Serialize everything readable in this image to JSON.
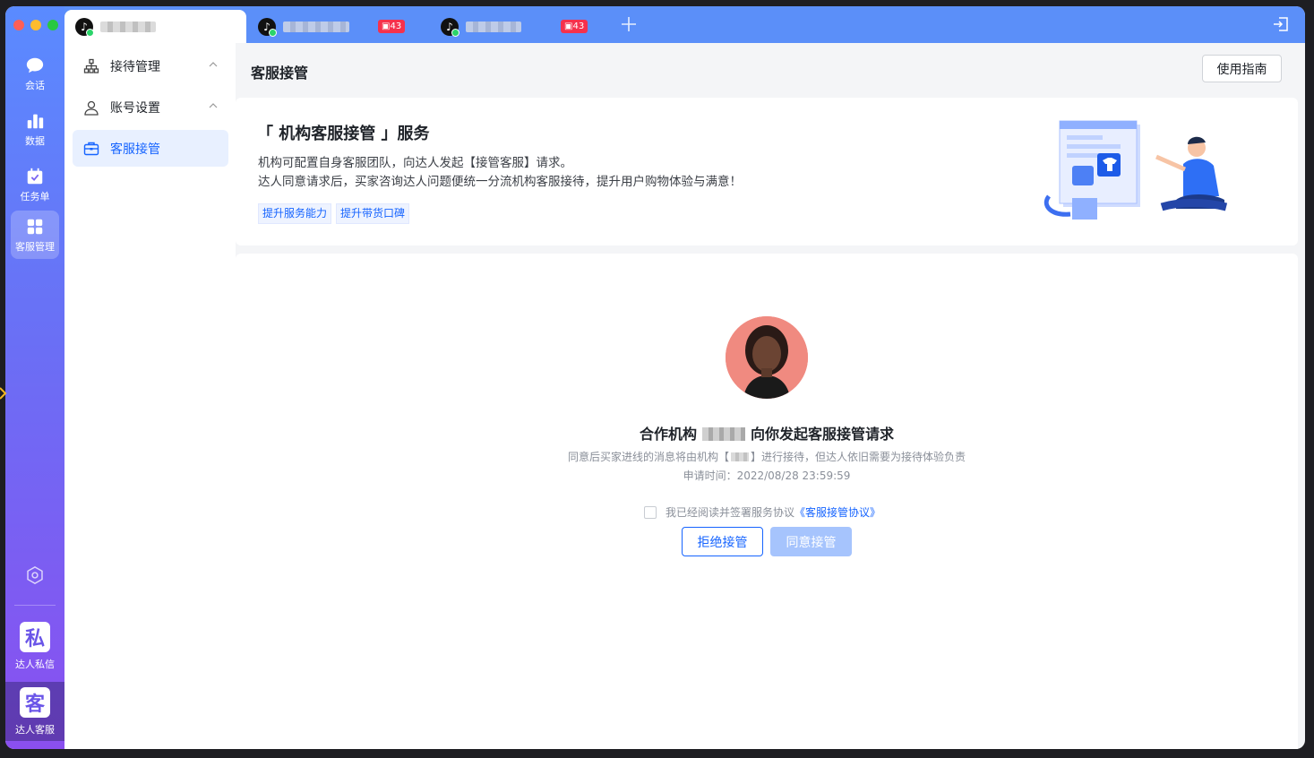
{
  "tabs": [
    {
      "label": "",
      "active": true
    },
    {
      "label": "",
      "badge": "43"
    },
    {
      "label": "",
      "badge": "43"
    }
  ],
  "rail": {
    "items": [
      {
        "label": "会话",
        "icon": "chat-icon"
      },
      {
        "label": "数据",
        "icon": "bar-chart-icon"
      },
      {
        "label": "任务单",
        "icon": "task-icon"
      },
      {
        "label": "客服管理",
        "icon": "grid-icon",
        "active": true
      }
    ],
    "apps": [
      {
        "label": "达人私信",
        "glyph": "私"
      },
      {
        "label": "达人客服",
        "glyph": "客",
        "active": true
      }
    ]
  },
  "nav": {
    "items": [
      {
        "label": "接待管理",
        "icon": "org-chart-icon",
        "expandable": true
      },
      {
        "label": "账号设置",
        "icon": "user-icon",
        "expandable": true
      },
      {
        "label": "客服接管",
        "icon": "briefcase-icon",
        "active": true
      }
    ]
  },
  "header": {
    "title": "客服接管",
    "guide_button": "使用指南"
  },
  "service": {
    "title": "「 机构客服接管 」服务",
    "desc_line1": "机构可配置自身客服团队，向达人发起【接管客服】请求。",
    "desc_line2": "达人同意请求后，买家咨询达人问题便统一分流机构客服接待，提升用户购物体验与满意！",
    "tags": [
      "提升服务能力",
      "提升带货口碑"
    ]
  },
  "request": {
    "title_prefix": "合作机构",
    "title_suffix": "向你发起客服接管请求",
    "sub_prefix": "同意后买家进线的消息将由机构【",
    "sub_suffix": "】进行接待，但达人依旧需要为接待体验负责",
    "time": "申请时间：2022/08/28 23:59:59",
    "agreement_text": "我已经阅读并签署服务协议",
    "agreement_link": "《客服接管协议》",
    "reject_button": "拒绝接管",
    "accept_button": "同意接管"
  },
  "colors": {
    "accent": "#1664ff",
    "tabbar": "#5b8ff9",
    "badge": "#f5314c"
  }
}
